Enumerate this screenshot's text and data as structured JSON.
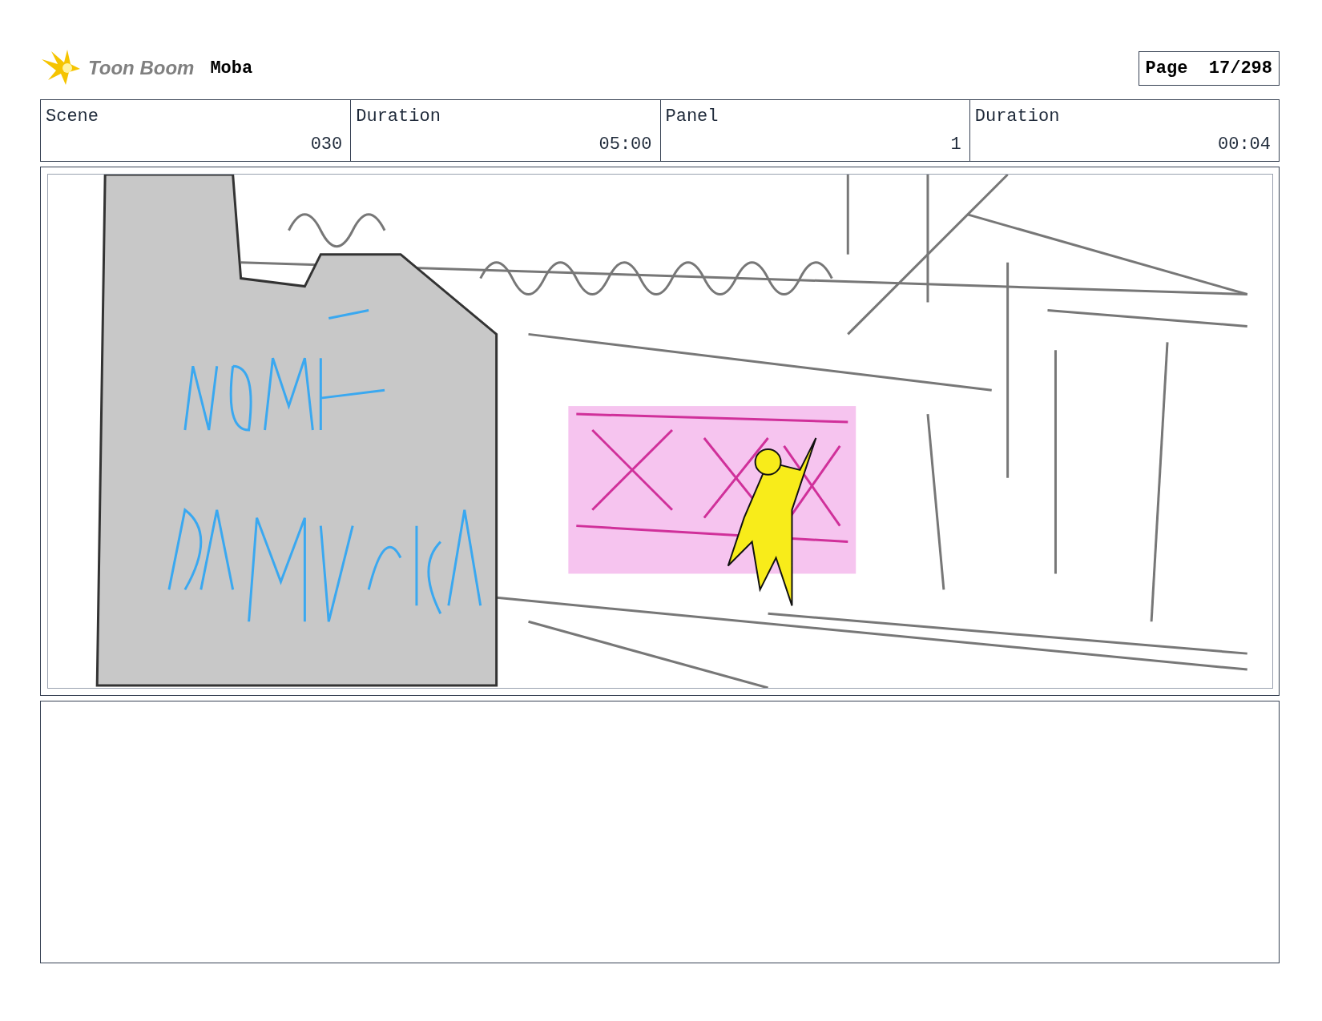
{
  "header": {
    "brand": "Toon Boom",
    "project": "Moba",
    "page": "Page  17/298"
  },
  "info_table": {
    "columns": [
      "Scene",
      "Duration",
      "Panel",
      "Duration"
    ],
    "values": [
      "030",
      "05:00",
      "1",
      "00:04"
    ]
  }
}
